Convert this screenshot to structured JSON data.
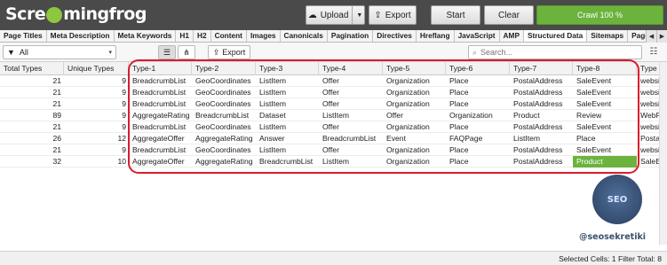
{
  "app": {
    "logo_text": "Screamingfrog",
    "brand_color": "#6cb33e"
  },
  "toolbar": {
    "upload_label": "Upload",
    "export_label": "Export",
    "start_label": "Start",
    "clear_label": "Clear",
    "crawl_label": "Crawl 100 %",
    "crawl_progress": 1.0
  },
  "tabs": [
    "Page Titles",
    "Meta Description",
    "Meta Keywords",
    "H1",
    "H2",
    "Content",
    "Images",
    "Canonicals",
    "Pagination",
    "Directives",
    "Hreflang",
    "JavaScript",
    "AMP",
    "Structured Data",
    "Sitemaps",
    "PageS"
  ],
  "active_tab": "Structured Data",
  "filter": {
    "selected": "All",
    "export_label": "Export",
    "search_placeholder": "Search..."
  },
  "table": {
    "columns": [
      "Total Types",
      "Unique Types",
      "Type-1",
      "Type-2",
      "Type-3",
      "Type-4",
      "Type-5",
      "Type-6",
      "Type-7",
      "Type-8",
      "Type"
    ],
    "rows": [
      [
        "21",
        "9",
        "BreadcrumbList",
        "GeoCoordinates",
        "ListItem",
        "Offer",
        "Organization",
        "Place",
        "PostalAddress",
        "SaleEvent",
        "website"
      ],
      [
        "21",
        "9",
        "BreadcrumbList",
        "GeoCoordinates",
        "ListItem",
        "Offer",
        "Organization",
        "Place",
        "PostalAddress",
        "SaleEvent",
        "website"
      ],
      [
        "21",
        "9",
        "BreadcrumbList",
        "GeoCoordinates",
        "ListItem",
        "Offer",
        "Organization",
        "Place",
        "PostalAddress",
        "SaleEvent",
        "website"
      ],
      [
        "89",
        "9",
        "AggregateRating",
        "BreadcrumbList",
        "Dataset",
        "ListItem",
        "Offer",
        "Organization",
        "Product",
        "Review",
        "WebPa"
      ],
      [
        "21",
        "9",
        "BreadcrumbList",
        "GeoCoordinates",
        "ListItem",
        "Offer",
        "Organization",
        "Place",
        "PostalAddress",
        "SaleEvent",
        "website"
      ],
      [
        "26",
        "12",
        "AggregateOffer",
        "AggregateRating",
        "Answer",
        "BreadcrumbList",
        "Event",
        "FAQPage",
        "ListItem",
        "Place",
        "PostalA"
      ],
      [
        "21",
        "9",
        "BreadcrumbList",
        "GeoCoordinates",
        "ListItem",
        "Offer",
        "Organization",
        "Place",
        "PostalAddress",
        "SaleEvent",
        "website"
      ],
      [
        "32",
        "10",
        "AggregateOffer",
        "AggregateRating",
        "BreadcrumbList",
        "ListItem",
        "Organization",
        "Place",
        "PostalAddress",
        "Product",
        "SaleEve"
      ]
    ]
  },
  "watermark": {
    "badge_text": "SEO",
    "handle": "@seosekretiki"
  },
  "status": {
    "text": "Selected Cells: 1  Filter Total: 8"
  }
}
